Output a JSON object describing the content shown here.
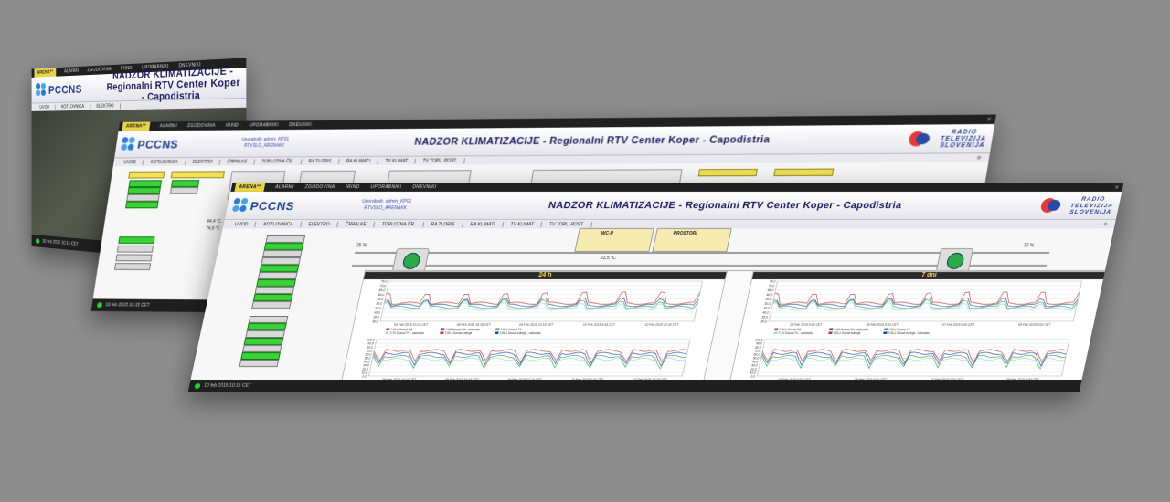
{
  "topbar": {
    "items": [
      "ARENA**",
      "ALARMI",
      "ZGODOVINA",
      "IRIND",
      "UPORABNIKI",
      "DNEVNIKI"
    ]
  },
  "header": {
    "logo": "PCCNS",
    "user_line1": "Uporabnik: admin_KP01",
    "user_line2": "RTVSLO_ARENAKK",
    "title": "NADZOR KLIMATIZACIJE - Regionalni RTV Center Koper - Capodistria",
    "broadcaster_line1": "RADIO",
    "broadcaster_line2": "TELEVIZIJA",
    "broadcaster_line3": "SLOVENIJA"
  },
  "nav": {
    "items": [
      "UVOD",
      "KOTLOVNICA",
      "ELEKTRO",
      "ČRPALKE",
      "TOPLOTNA ČR.",
      "RA TLORIS",
      "RA KLIMATI",
      "TV KLIMAT",
      "TV TOPL. POST."
    ]
  },
  "status": {
    "timestamp1": "10 feb 2015 10:15 CET",
    "timestamp2": "10 feb 2015 10:15 CET",
    "timestamp3": "10 feb 2015 10:15 CET"
  },
  "scada": {
    "rooms": [
      "WC-P",
      "PROSTORI"
    ],
    "labels": [
      "NAPRAVE S1",
      "SEZNAM NAPRAV",
      "ODPRTO",
      "ZAPRTO",
      "ROCNO",
      "AVTOMATSKO"
    ],
    "temps": [
      "44,4 °C",
      "74,6 °C",
      "22,5 °C",
      "34 °C",
      "25 %",
      "22 %",
      "57 %"
    ]
  },
  "graphs": {
    "title_24h": "24 h",
    "title_7d": "7 dni",
    "legend_24h_top": [
      "T-RL1 Dovod RA",
      "T-RA Dovod RA - računsko",
      "T-RL1 Dovod TV",
      "T-TV Dovod TV - računsko",
      "T-RL1 Dovod kuhinja",
      "T-RL1 Dovod kuhinja - računsko"
    ],
    "legend_24h_bottom": [
      "T1 - zunanja",
      "T1 - vlažnost",
      "T1 - rosišče",
      "T1 - rel.vlažnost"
    ],
    "x_24h": [
      "09 Feb 2015 10:16 CET",
      "09 Feb 2015 16:16 CET",
      "09 Feb 2015 22:16 CET",
      "10 Feb 2015 4:16 CET",
      "10 Feb 2015 10:16 CET"
    ],
    "x_7d": [
      "03 Feb 2015 0:00 CET",
      "05 Feb 2015 0:00 CET",
      "07 Feb 2015 0:00 CET",
      "09 Feb 2015 0:00 CET"
    ],
    "y_top_ticks": [
      "75,0",
      "70,0",
      "65,0",
      "60,0",
      "55,0",
      "50,0",
      "45,0",
      "40,0",
      "35,0",
      "30,0"
    ],
    "y_bottom_ticks": [
      "100,0",
      "90,0",
      "80,0",
      "70,0",
      "60,0",
      "50,0",
      "40,0",
      "30,0",
      "20,0",
      "10,0",
      "0,0"
    ]
  },
  "colors": {
    "accent": "#e8d34a",
    "series_red": "#c0392b",
    "series_blue": "#2e3aa8",
    "series_green": "#2ea84a",
    "series_light": "#9ad7e8"
  }
}
